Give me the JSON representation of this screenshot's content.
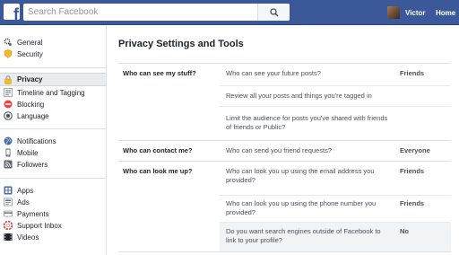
{
  "topbar": {
    "search_placeholder": "Search Facebook",
    "user_name": "Victor",
    "home_label": "Home",
    "brand_color": "#3b5998"
  },
  "sidebar": {
    "groups": [
      {
        "items": [
          {
            "label": "General",
            "icon": "gear-icon"
          },
          {
            "label": "Security",
            "icon": "shield-icon"
          }
        ]
      },
      {
        "items": [
          {
            "label": "Privacy",
            "icon": "lock-icon",
            "active": true
          },
          {
            "label": "Timeline and Tagging",
            "icon": "timeline-icon"
          },
          {
            "label": "Blocking",
            "icon": "block-icon"
          },
          {
            "label": "Language",
            "icon": "globe-icon"
          }
        ]
      },
      {
        "items": [
          {
            "label": "Notifications",
            "icon": "globe-icon"
          },
          {
            "label": "Mobile",
            "icon": "mobile-icon"
          },
          {
            "label": "Followers",
            "icon": "rss-icon"
          }
        ]
      },
      {
        "items": [
          {
            "label": "Apps",
            "icon": "apps-icon"
          },
          {
            "label": "Ads",
            "icon": "ads-icon"
          },
          {
            "label": "Payments",
            "icon": "payments-icon"
          },
          {
            "label": "Support Inbox",
            "icon": "support-icon"
          },
          {
            "label": "Videos",
            "icon": "video-icon"
          }
        ]
      }
    ]
  },
  "main": {
    "title": "Privacy Settings and Tools",
    "sections": [
      {
        "label": "Who can see my stuff?",
        "rows": [
          {
            "question": "Who can see your future posts?",
            "value": "Friends"
          },
          {
            "question": "Review all your posts and things you're tagged in",
            "value": ""
          },
          {
            "question": "Limit the audience for posts you've shared with friends of friends or Public?",
            "value": ""
          }
        ]
      },
      {
        "label": "Who can contact me?",
        "rows": [
          {
            "question": "Who can send you friend requests?",
            "value": "Everyone"
          }
        ]
      },
      {
        "label": "Who can look me up?",
        "rows": [
          {
            "question": "Who can look you up using the email address you provided?",
            "value": "Friends"
          },
          {
            "question": "Who can look you up using the phone number you provided?",
            "value": "Friends"
          },
          {
            "question": "Do you want search engines outside of Facebook to link to your profile?",
            "value": "No",
            "shaded": true
          }
        ]
      }
    ]
  }
}
